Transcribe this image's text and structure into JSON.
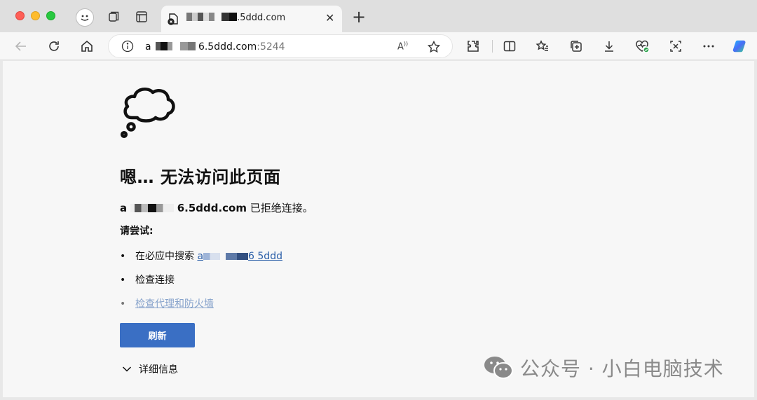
{
  "tab": {
    "title_visible": ".5ddd.com"
  },
  "address_bar": {
    "url_prefix": "a",
    "url_host_visible": "6.5ddd.com",
    "url_port": ":5244"
  },
  "error": {
    "title": "嗯… 无法访问此页面",
    "host_prefix": "a",
    "host_visible": "6.5ddd.com",
    "message": "已拒绝连接。",
    "try_heading": "请尝试:",
    "suggestions": [
      {
        "text": "在必应中搜索",
        "link_prefix": "a",
        "link_suffix": "6 5ddd"
      },
      {
        "text": "检查连接"
      },
      {
        "link": "检查代理和防火墙"
      }
    ],
    "refresh_label": "刷新",
    "details_label": "详细信息"
  },
  "watermark": {
    "text": "公众号 · 小白电脑技术"
  },
  "colors": {
    "accent": "#3a6fc4",
    "link": "#2a5ea8"
  }
}
